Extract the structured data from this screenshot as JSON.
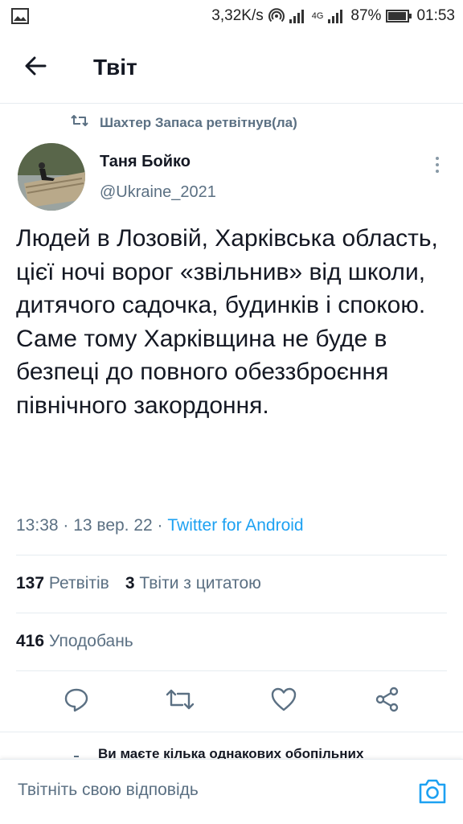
{
  "statusbar": {
    "speed": "3,32K/s",
    "network": "4G",
    "battery": "87%",
    "time": "01:53"
  },
  "header": {
    "title": "Твіт"
  },
  "retweet_note": "Шахтер Запаса ретвітнув(ла)",
  "tweet": {
    "author_name": "Таня Бойко",
    "author_handle": "@Ukraine_2021",
    "text": "Людей в Лозовій, Харківська область, цієї ночі ворог «звільнив» від школи, дитячого садочка, будинків і спокою. Саме тому Харківщина не буде в безпеці до повного обеззброєння північного закордоння.",
    "timestamp": "13:38 · 13 вер. 22 · ",
    "source": "Twitter for Android"
  },
  "stats": {
    "retweets_count": "137",
    "retweets_label": "Ретвітів",
    "quotes_count": "3",
    "quotes_label": "Твіти з цитатою",
    "likes_count": "416",
    "likes_label": "Уподобань"
  },
  "notice": "Ви маєте кілька однакових обопільних",
  "reply": {
    "placeholder": "Твітніть свою відповідь"
  },
  "icons": {
    "back": "arrow-left-icon",
    "retweet": "retweet-icon",
    "more": "more-vertical-icon",
    "reply": "reply-icon",
    "like": "heart-icon",
    "share": "share-icon",
    "camera": "camera-icon"
  },
  "colors": {
    "accent": "#1da1f2",
    "secondary_text": "#5b7083",
    "primary_text": "#141823"
  }
}
